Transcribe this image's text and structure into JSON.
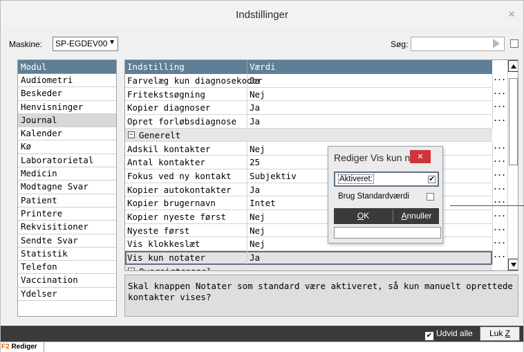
{
  "window": {
    "title": "Indstillinger"
  },
  "toolbar": {
    "machine_label": "Maskine:",
    "machine_value": "SP-EGDEV00",
    "search_label": "Søg:",
    "search_value": ""
  },
  "modules": {
    "header": "Modul",
    "items": [
      "Audiometri",
      "Beskeder",
      "Henvisninger",
      "Journal",
      "Kalender",
      "Kø",
      "Laboratorietal",
      "Medicin",
      "Modtagne Svar",
      "Patient",
      "Printere",
      "Rekvisitioner",
      "Sendte Svar",
      "Statistik",
      "Telefon",
      "Vaccination",
      "Ydelser"
    ],
    "selected": "Journal"
  },
  "grid": {
    "col_setting": "Indstilling",
    "col_value": "Værdi",
    "rows": [
      {
        "setting": "Farvelæg kun diagnosekoder",
        "value": "Ja"
      },
      {
        "setting": "Fritekstsøgning",
        "value": "Nej"
      },
      {
        "setting": "Kopier diagnoser",
        "value": "Ja"
      },
      {
        "setting": "Opret forløbsdiagnose",
        "value": "Ja"
      },
      {
        "group": "Generelt"
      },
      {
        "setting": "Adskil kontakter",
        "value": "Nej"
      },
      {
        "setting": "Antal kontakter",
        "value": "25"
      },
      {
        "setting": "Fokus ved ny kontakt",
        "value": "Subjektiv"
      },
      {
        "setting": "Kopier autokontakter",
        "value": "Ja"
      },
      {
        "setting": "Kopier brugernavn",
        "value": "Intet"
      },
      {
        "setting": "Kopier nyeste først",
        "value": "Nej"
      },
      {
        "setting": "Nyeste først",
        "value": "Nej"
      },
      {
        "setting": "Vis klokkeslæt",
        "value": "Nej"
      },
      {
        "setting": "Vis kun notater",
        "value": "Ja"
      },
      {
        "group": "Oversigtspanel"
      }
    ],
    "ellipsis": "...",
    "collapse_glyph": "−"
  },
  "description": "Skal knappen Notater som standard være aktiveret, så kun manuelt oprettede kontakter vises?",
  "bottom": {
    "expand_all": "Udvid alle",
    "expand_checked": "✔",
    "close_prefix": "Luk ",
    "close_key": "Z"
  },
  "status": {
    "key": "F2",
    "label": "Rediger"
  },
  "dialog": {
    "title": "Rediger Vis kun no...",
    "activated_label": "Aktiveret:",
    "activated_checked": "✔",
    "default_label": "Brug Standardværdi",
    "ok_key": "O",
    "ok_rest": "K",
    "cancel_key": "A",
    "cancel_rest": "nnuller"
  }
}
